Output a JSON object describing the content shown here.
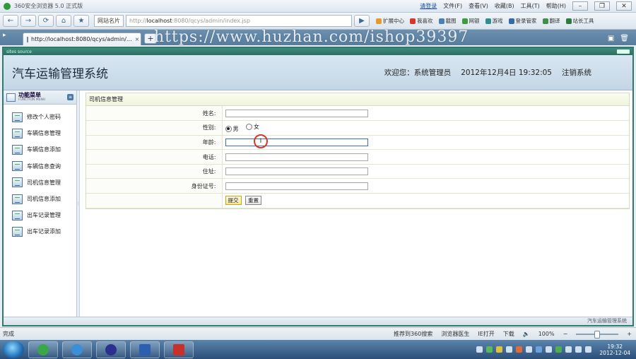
{
  "browser": {
    "title": "360安全浏览器 5.0 正式版",
    "login_link": "请登录",
    "menus": [
      "文件(F)",
      "查看(V)",
      "收藏(B)",
      "工具(T)",
      "帮助(H)"
    ],
    "fav_label": "网站名片",
    "url_prefix": "http://",
    "url_host": "localhost",
    "url_rest": ":8080/qcys/admin/index.jsp",
    "toolbar_items": [
      "扩展中心",
      "我喜欢",
      "截图",
      "网银",
      "游戏",
      "登录管家",
      "翻译",
      "站长工具"
    ],
    "tab_title": "http://localhost:8080/qcys/admin/...",
    "tab_close": "×",
    "new_tab": "+",
    "watermark": "https://www.huzhan.com/ishop39397",
    "status_left": "完成",
    "status_items": [
      "推荐到360搜索",
      "浏览器医生",
      "IE打开",
      "下载"
    ],
    "zoom": "100%"
  },
  "app": {
    "frame_label": "sites source",
    "system_title": "汽车运输管理系统",
    "welcome": "欢迎您：系统管理员",
    "datetime": "2012年12月4日  19:32:05",
    "logout": "注销系统",
    "footer": "汽车运输管理系统"
  },
  "sidebar": {
    "title": "功能菜单",
    "subtitle": "FUNCTION MENU",
    "items": [
      {
        "label": "修改个人密码"
      },
      {
        "label": "车辆信息管理"
      },
      {
        "label": "车辆信息添加"
      },
      {
        "label": "车辆信息查询"
      },
      {
        "label": "司机信息管理"
      },
      {
        "label": "司机信息添加"
      },
      {
        "label": "出车记录管理"
      },
      {
        "label": "出车记录添加"
      }
    ]
  },
  "form": {
    "title": "司机信息管理",
    "name_label": "姓名:",
    "gender_label": "性别:",
    "gender_male": "男",
    "gender_female": "女",
    "gender_selected": "男",
    "age_label": "年龄:",
    "phone_label": "电话:",
    "address_label": "住址:",
    "idcard_label": "身份证号:",
    "submit": "提交",
    "reset": "重置",
    "cursor_glyph": "I"
  },
  "taskbar": {
    "time": "19:32",
    "date": "2012-12-04"
  },
  "colors": {
    "frame_border": "#2f7a6c",
    "header_bg": "#d8e6f1",
    "panel_title_bg": "#f0f5dc",
    "cursor_circle": "#d9352c"
  }
}
